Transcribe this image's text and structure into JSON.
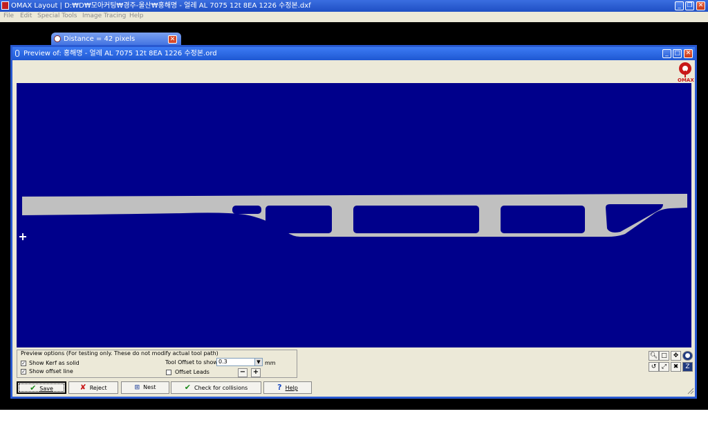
{
  "app": {
    "title": "OMAX Layout | D:₩D₩모아커팅₩경주-울산₩홍해명 - 얼레 AL 7075 12t 8EA 1226 수정본.dxf",
    "menu": [
      "File",
      "Edit",
      "Special Tools",
      "Image Tracing",
      "Help"
    ]
  },
  "distance_window": {
    "title": "Distance = 42 pixels"
  },
  "preview": {
    "title": "Preview of: 홍해명 - 얼레 AL 7075 12t 8EA 1226 수정본.ord",
    "logo_text": "OMAX",
    "canvas_bg": "#00008b",
    "part_color": "#c0c0c0"
  },
  "options": {
    "title": "Preview options (For testing only. These do not modify actual tool path)",
    "show_kerf_label": "Show Kerf as solid",
    "show_kerf_checked": "✓",
    "show_offset_label": "Show offset line",
    "show_offset_checked": "✓",
    "tool_offset_label": "Tool Offset to show:",
    "tool_offset_value": "0.3",
    "tool_offset_unit": "mm",
    "offset_leads_label": "Offset Leads",
    "minus": "−",
    "plus": "+"
  },
  "buttons": {
    "save": "Save",
    "reject": "Reject",
    "nest": "Nest",
    "check": "Check for collisions",
    "help": "Help"
  }
}
